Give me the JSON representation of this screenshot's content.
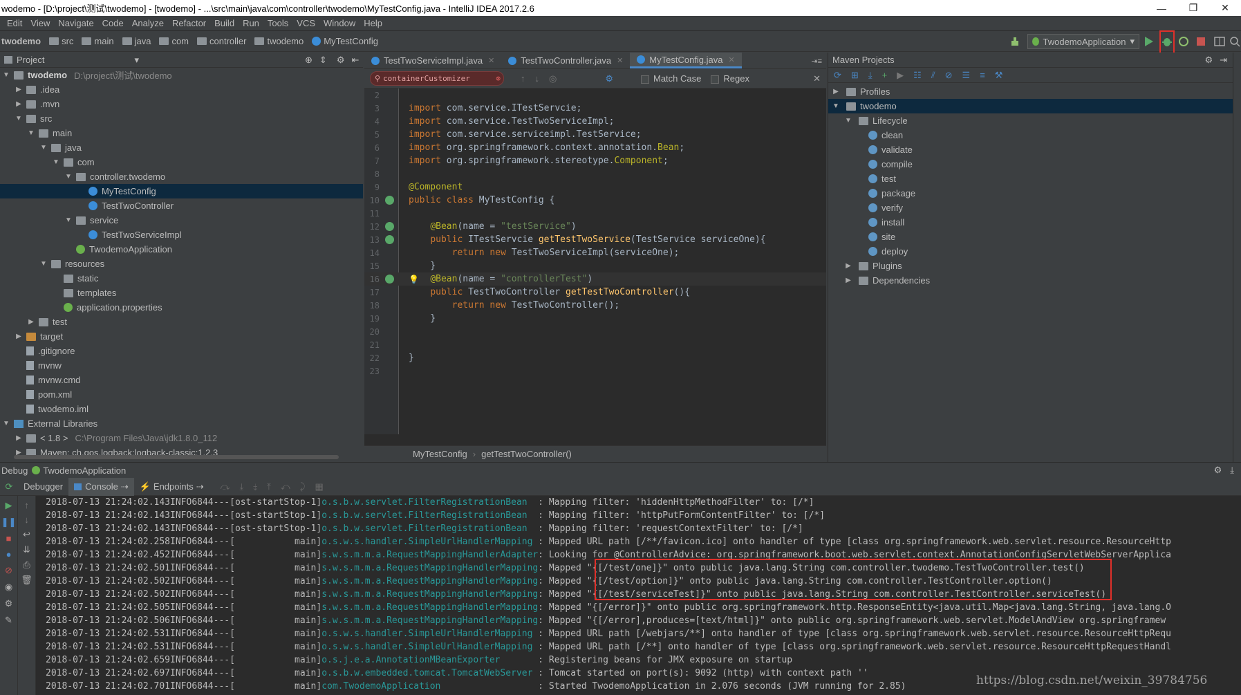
{
  "window": {
    "title": "wodemo - [D:\\project\\测试\\twodemo] - [twodemo] - ...\\src\\main\\java\\com\\controller\\twodemo\\MyTestConfig.java - IntelliJ IDEA 2017.2.6"
  },
  "menu": [
    "Edit",
    "View",
    "Navigate",
    "Code",
    "Analyze",
    "Refactor",
    "Build",
    "Run",
    "Tools",
    "VCS",
    "Window",
    "Help"
  ],
  "breadcrumbs": [
    "twodemo",
    "src",
    "main",
    "java",
    "com",
    "controller",
    "twodemo",
    "MyTestConfig"
  ],
  "run_config": "TwodemoApplication",
  "project_panel": {
    "title": "Project",
    "tree": [
      {
        "label": "twodemo",
        "extra": "D:\\project\\测试\\twodemo",
        "depth": 0,
        "icon": "module",
        "arrow": "down"
      },
      {
        "label": ".idea",
        "depth": 1,
        "icon": "folder",
        "arrow": "right"
      },
      {
        "label": ".mvn",
        "depth": 1,
        "icon": "folder",
        "arrow": "right"
      },
      {
        "label": "src",
        "depth": 1,
        "icon": "folder",
        "arrow": "down"
      },
      {
        "label": "main",
        "depth": 2,
        "icon": "folder",
        "arrow": "down"
      },
      {
        "label": "java",
        "depth": 3,
        "icon": "folder",
        "arrow": "down"
      },
      {
        "label": "com",
        "depth": 4,
        "icon": "folder",
        "arrow": "down"
      },
      {
        "label": "controller.twodemo",
        "depth": 5,
        "icon": "folder",
        "arrow": "down"
      },
      {
        "label": "MyTestConfig",
        "depth": 6,
        "icon": "cls",
        "arrow": "",
        "selected": true
      },
      {
        "label": "TestTwoController",
        "depth": 6,
        "icon": "cls",
        "arrow": ""
      },
      {
        "label": "service",
        "depth": 5,
        "icon": "folder",
        "arrow": "down"
      },
      {
        "label": "TestTwoServiceImpl",
        "depth": 6,
        "icon": "cls",
        "arrow": ""
      },
      {
        "label": "TwodemoApplication",
        "depth": 5,
        "icon": "spring",
        "arrow": ""
      },
      {
        "label": "resources",
        "depth": 3,
        "icon": "folder",
        "arrow": "down"
      },
      {
        "label": "static",
        "depth": 4,
        "icon": "folder",
        "arrow": ""
      },
      {
        "label": "templates",
        "depth": 4,
        "icon": "folder",
        "arrow": ""
      },
      {
        "label": "application.properties",
        "depth": 4,
        "icon": "spring",
        "arrow": ""
      },
      {
        "label": "test",
        "depth": 2,
        "icon": "folder",
        "arrow": "right"
      },
      {
        "label": "target",
        "depth": 1,
        "icon": "ofolder",
        "arrow": "right"
      },
      {
        "label": ".gitignore",
        "depth": 1,
        "icon": "file",
        "arrow": ""
      },
      {
        "label": "mvnw",
        "depth": 1,
        "icon": "file",
        "arrow": ""
      },
      {
        "label": "mvnw.cmd",
        "depth": 1,
        "icon": "file",
        "arrow": ""
      },
      {
        "label": "pom.xml",
        "depth": 1,
        "icon": "file",
        "arrow": ""
      },
      {
        "label": "twodemo.iml",
        "depth": 1,
        "icon": "file",
        "arrow": ""
      },
      {
        "label": "External Libraries",
        "depth": 0,
        "icon": "lib",
        "arrow": "down"
      },
      {
        "label": "< 1.8 >",
        "extra": "C:\\Program Files\\Java\\jdk1.8.0_112",
        "depth": 1,
        "icon": "folder",
        "arrow": "right"
      },
      {
        "label": "Maven: ch.qos.logback:logback-classic:1.2.3",
        "depth": 1,
        "icon": "folder",
        "arrow": "right"
      }
    ]
  },
  "editor": {
    "tabs": [
      {
        "label": "TestTwoServiceImpl.java",
        "active": false
      },
      {
        "label": "TestTwoController.java",
        "active": false
      },
      {
        "label": "MyTestConfig.java",
        "active": true
      }
    ],
    "find": {
      "value": "containerCustomizer",
      "match_case": "Match Case",
      "regex": "Regex"
    },
    "lines": [
      {
        "no": "2",
        "tokens": []
      },
      {
        "no": "3",
        "tokens": [
          [
            "kw",
            "import "
          ],
          [
            "",
            "com.service.ITestServcie;"
          ]
        ]
      },
      {
        "no": "4",
        "tokens": [
          [
            "kw",
            "import "
          ],
          [
            "",
            "com.service.TestTwoServiceImpl;"
          ]
        ]
      },
      {
        "no": "5",
        "tokens": [
          [
            "kw",
            "import "
          ],
          [
            "",
            "com.service.serviceimpl.TestService;"
          ]
        ]
      },
      {
        "no": "6",
        "tokens": [
          [
            "kw",
            "import "
          ],
          [
            "",
            "org.springframework.context.annotation."
          ],
          [
            "an",
            "Bean"
          ],
          [
            "",
            ";"
          ]
        ]
      },
      {
        "no": "7",
        "tokens": [
          [
            "kw",
            "import "
          ],
          [
            "",
            "org.springframework.stereotype."
          ],
          [
            "an",
            "Component"
          ],
          [
            "",
            ";"
          ]
        ]
      },
      {
        "no": "8",
        "tokens": []
      },
      {
        "no": "9",
        "tokens": [
          [
            "an",
            "@Component"
          ]
        ]
      },
      {
        "no": "10",
        "tokens": [
          [
            "kw",
            "public class "
          ],
          [
            "",
            "MyTestConfig {"
          ]
        ]
      },
      {
        "no": "11",
        "tokens": []
      },
      {
        "no": "12",
        "tokens": [
          [
            "",
            "    "
          ],
          [
            "an",
            "@Bean"
          ],
          [
            "",
            "(name = "
          ],
          [
            "st",
            "\"testService\""
          ],
          [
            "",
            ")"
          ]
        ]
      },
      {
        "no": "13",
        "tokens": [
          [
            "",
            "    "
          ],
          [
            "kw",
            "public "
          ],
          [
            "",
            "ITestServcie "
          ],
          [
            "fn",
            "getTestTwoService"
          ],
          [
            "",
            "(TestService serviceOne){"
          ]
        ]
      },
      {
        "no": "14",
        "tokens": [
          [
            "",
            "        "
          ],
          [
            "kw",
            "return new "
          ],
          [
            "",
            "TestTwoServiceImpl(serviceOne);"
          ]
        ]
      },
      {
        "no": "15",
        "tokens": [
          [
            "",
            "    }"
          ]
        ]
      },
      {
        "no": "16",
        "tokens": [
          [
            "",
            "    "
          ],
          [
            "an",
            "@Bean"
          ],
          [
            "",
            "(name = "
          ],
          [
            "st",
            "\"controllerTest\""
          ],
          [
            "",
            ")"
          ]
        ],
        "current": true
      },
      {
        "no": "17",
        "tokens": [
          [
            "",
            "    "
          ],
          [
            "kw",
            "public "
          ],
          [
            "",
            "TestTwoController "
          ],
          [
            "fn",
            "getTestTwoController"
          ],
          [
            "",
            "(){"
          ]
        ]
      },
      {
        "no": "18",
        "tokens": [
          [
            "",
            "        "
          ],
          [
            "kw",
            "return new "
          ],
          [
            "",
            "TestTwoController();"
          ]
        ]
      },
      {
        "no": "19",
        "tokens": [
          [
            "",
            "    }"
          ]
        ]
      },
      {
        "no": "20",
        "tokens": []
      },
      {
        "no": "21",
        "tokens": []
      },
      {
        "no": "22",
        "tokens": [
          [
            "",
            "}"
          ]
        ]
      },
      {
        "no": "23",
        "tokens": []
      }
    ],
    "footer": [
      "MyTestConfig",
      "getTestTwoController()"
    ]
  },
  "maven": {
    "title": "Maven Projects",
    "items": [
      {
        "label": "Profiles",
        "depth": 0,
        "arrow": "right",
        "icon": "folder"
      },
      {
        "label": "twodemo",
        "depth": 0,
        "arrow": "down",
        "icon": "module",
        "selected": true
      },
      {
        "label": "Lifecycle",
        "depth": 1,
        "arrow": "down",
        "icon": "folder"
      },
      {
        "label": "clean",
        "depth": 2,
        "arrow": "",
        "icon": "gear"
      },
      {
        "label": "validate",
        "depth": 2,
        "arrow": "",
        "icon": "gear"
      },
      {
        "label": "compile",
        "depth": 2,
        "arrow": "",
        "icon": "gear"
      },
      {
        "label": "test",
        "depth": 2,
        "arrow": "",
        "icon": "gear"
      },
      {
        "label": "package",
        "depth": 2,
        "arrow": "",
        "icon": "gear"
      },
      {
        "label": "verify",
        "depth": 2,
        "arrow": "",
        "icon": "gear"
      },
      {
        "label": "install",
        "depth": 2,
        "arrow": "",
        "icon": "gear"
      },
      {
        "label": "site",
        "depth": 2,
        "arrow": "",
        "icon": "gear"
      },
      {
        "label": "deploy",
        "depth": 2,
        "arrow": "",
        "icon": "gear"
      },
      {
        "label": "Plugins",
        "depth": 1,
        "arrow": "right",
        "icon": "folder"
      },
      {
        "label": "Dependencies",
        "depth": 1,
        "arrow": "right",
        "icon": "folder"
      }
    ]
  },
  "debug": {
    "title": "Debug",
    "app": "TwodemoApplication",
    "tabs": [
      "Debugger",
      "Console",
      "Endpoints"
    ],
    "log": [
      [
        "2018-07-13 21:24:02.143",
        "INFO",
        "6844",
        "---",
        "[ost-startStop-1]",
        "o.s.b.w.servlet.FilterRegistrationBean  ",
        ": Mapping filter: 'hiddenHttpMethodFilter' to: [/*]"
      ],
      [
        "2018-07-13 21:24:02.143",
        "INFO",
        "6844",
        "---",
        "[ost-startStop-1]",
        "o.s.b.w.servlet.FilterRegistrationBean  ",
        ": Mapping filter: 'httpPutFormContentFilter' to: [/*]"
      ],
      [
        "2018-07-13 21:24:02.143",
        "INFO",
        "6844",
        "---",
        "[ost-startStop-1]",
        "o.s.b.w.servlet.FilterRegistrationBean  ",
        ": Mapping filter: 'requestContextFilter' to: [/*]"
      ],
      [
        "2018-07-13 21:24:02.258",
        "INFO",
        "6844",
        "---",
        "[           main]",
        "o.s.w.s.handler.SimpleUrlHandlerMapping ",
        ": Mapped URL path [/**/favicon.ico] onto handler of type [class org.springframework.web.servlet.resource.ResourceHttp"
      ],
      [
        "2018-07-13 21:24:02.452",
        "INFO",
        "6844",
        "---",
        "[           main]",
        "s.w.s.m.m.a.RequestMappingHandlerAdapter",
        ": Looking for @ControllerAdvice: org.springframework.boot.web.servlet.context.AnnotationConfigServletWebServerApplica"
      ],
      [
        "2018-07-13 21:24:02.501",
        "INFO",
        "6844",
        "---",
        "[           main]",
        "s.w.s.m.m.a.RequestMappingHandlerMapping",
        ": Mapped \"{[/test/one]}\" onto public java.lang.String com.controller.twodemo.TestTwoController.test()"
      ],
      [
        "2018-07-13 21:24:02.502",
        "INFO",
        "6844",
        "---",
        "[           main]",
        "s.w.s.m.m.a.RequestMappingHandlerMapping",
        ": Mapped \"{[/test/option]}\" onto public java.lang.String com.controller.TestController.option()"
      ],
      [
        "2018-07-13 21:24:02.502",
        "INFO",
        "6844",
        "---",
        "[           main]",
        "s.w.s.m.m.a.RequestMappingHandlerMapping",
        ": Mapped \"{[/test/serviceTest]}\" onto public java.lang.String com.controller.TestController.serviceTest()"
      ],
      [
        "2018-07-13 21:24:02.505",
        "INFO",
        "6844",
        "---",
        "[           main]",
        "s.w.s.m.m.a.RequestMappingHandlerMapping",
        ": Mapped \"{[/error]}\" onto public org.springframework.http.ResponseEntity<java.util.Map<java.lang.String, java.lang.O"
      ],
      [
        "2018-07-13 21:24:02.506",
        "INFO",
        "6844",
        "---",
        "[           main]",
        "s.w.s.m.m.a.RequestMappingHandlerMapping",
        ": Mapped \"{[/error],produces=[text/html]}\" onto public org.springframework.web.servlet.ModelAndView org.springframew"
      ],
      [
        "2018-07-13 21:24:02.531",
        "INFO",
        "6844",
        "---",
        "[           main]",
        "o.s.w.s.handler.SimpleUrlHandlerMapping ",
        ": Mapped URL path [/webjars/**] onto handler of type [class org.springframework.web.servlet.resource.ResourceHttpRequ"
      ],
      [
        "2018-07-13 21:24:02.531",
        "INFO",
        "6844",
        "---",
        "[           main]",
        "o.s.w.s.handler.SimpleUrlHandlerMapping ",
        ": Mapped URL path [/**] onto handler of type [class org.springframework.web.servlet.resource.ResourceHttpRequestHandl"
      ],
      [
        "2018-07-13 21:24:02.659",
        "INFO",
        "6844",
        "---",
        "[           main]",
        "o.s.j.e.a.AnnotationMBeanExporter       ",
        ": Registering beans for JMX exposure on startup"
      ],
      [
        "2018-07-13 21:24:02.697",
        "INFO",
        "6844",
        "---",
        "[           main]",
        "o.s.b.w.embedded.tomcat.TomcatWebServer ",
        ": Tomcat started on port(s): 9092 (http) with context path ''"
      ],
      [
        "2018-07-13 21:24:02.701",
        "INFO",
        "6844",
        "---",
        "[           main]",
        "com.TwodemoApplication                  ",
        ": Started TwodemoApplication in 2.076 seconds (JVM running for 2.85)"
      ]
    ]
  },
  "watermark": "https://blog.csdn.net/weixin_39784756",
  "colors": {
    "highlight_box": "#e0302a",
    "accent": "#4a88c7"
  }
}
